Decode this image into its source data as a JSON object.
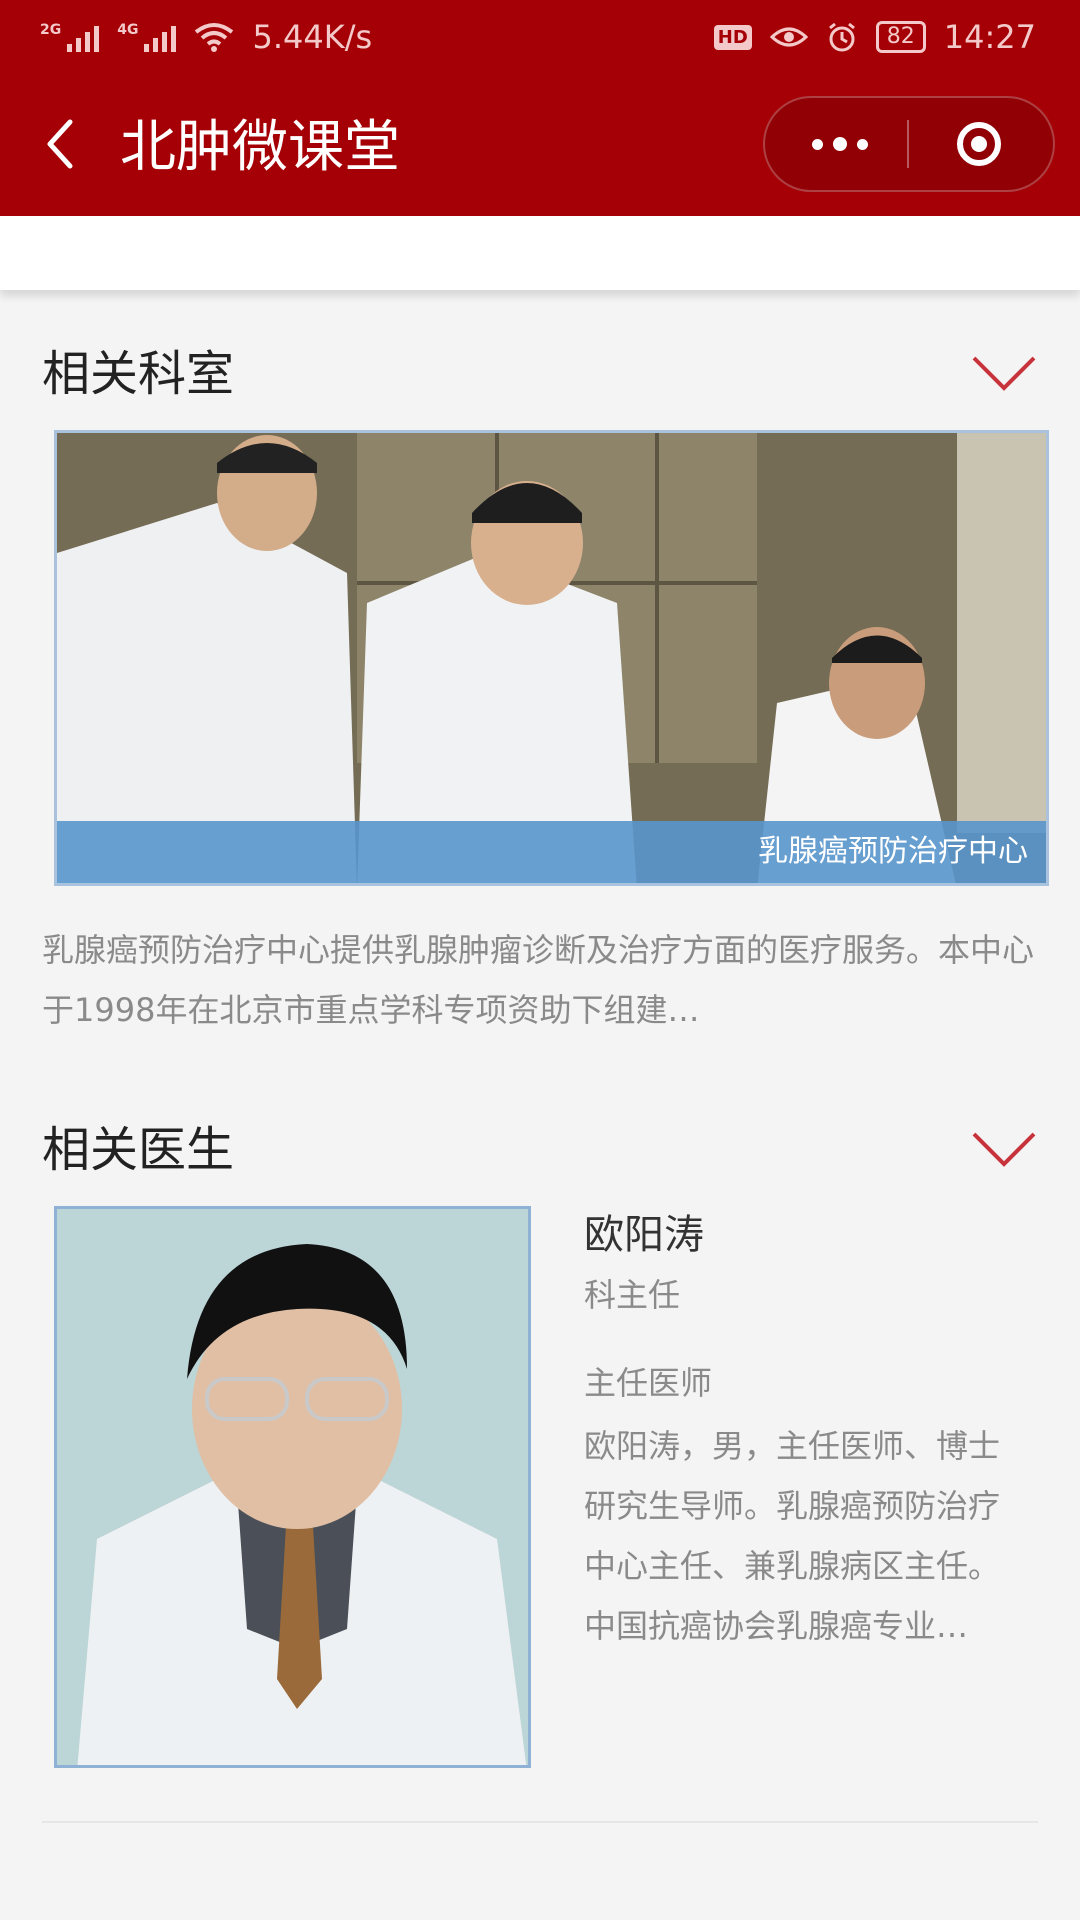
{
  "status_bar": {
    "signal_1": "2G",
    "signal_2": "4G",
    "speed": "5.44K/s",
    "hd": "HD",
    "battery": "82",
    "time": "14:27"
  },
  "header": {
    "title": "北肿微课堂",
    "back_icon": "chevron-left-icon",
    "more_icon": "more-dots-icon",
    "close_icon": "target-close-icon"
  },
  "departments": {
    "section_title": "相关科室",
    "image_caption": "乳腺癌预防治疗中心",
    "description": "乳腺癌预防治疗中心提供乳腺肿瘤诊断及治疗方面的医疗服务。本中心于1998年在北京市重点学科专项资助下组建…"
  },
  "doctors": {
    "section_title": "相关医生",
    "name": "欧阳涛",
    "role": "科主任",
    "title": "主任医师",
    "bio": "欧阳涛，男，主任医师、博士研究生导师。乳腺癌预防治疗中心主任、兼乳腺病区主任。中国抗癌协会乳腺癌专业…"
  },
  "colors": {
    "brand_red": "#a50006",
    "chevron_red": "#c8323a",
    "caption_blue": "#5896cc"
  }
}
